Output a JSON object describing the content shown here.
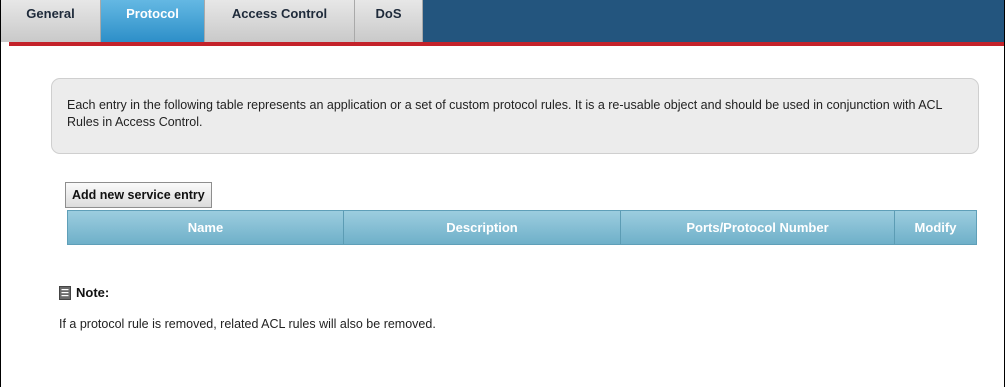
{
  "tabs": [
    {
      "label": "General",
      "active": false
    },
    {
      "label": "Protocol",
      "active": true
    },
    {
      "label": "Access Control",
      "active": false
    },
    {
      "label": "DoS",
      "active": false
    }
  ],
  "info": {
    "text": "Each entry in the following table represents an application or a set of custom protocol rules. It is a re-usable object and should be used in conjunction with ACL Rules in Access Control."
  },
  "add_button_label": "Add new service entry",
  "table": {
    "columns": [
      "Name",
      "Description",
      "Ports/Protocol Number",
      "Modify"
    ],
    "rows": []
  },
  "note": {
    "title": "Note:",
    "icon": "document-icon",
    "text": "If a protocol rule is removed, related ACL rules will also be removed."
  },
  "colors": {
    "tab_bar": "#23557e",
    "active_tab": "#2d8fc8",
    "accent_line": "#c4222a",
    "table_header": "#6fb0c9"
  }
}
